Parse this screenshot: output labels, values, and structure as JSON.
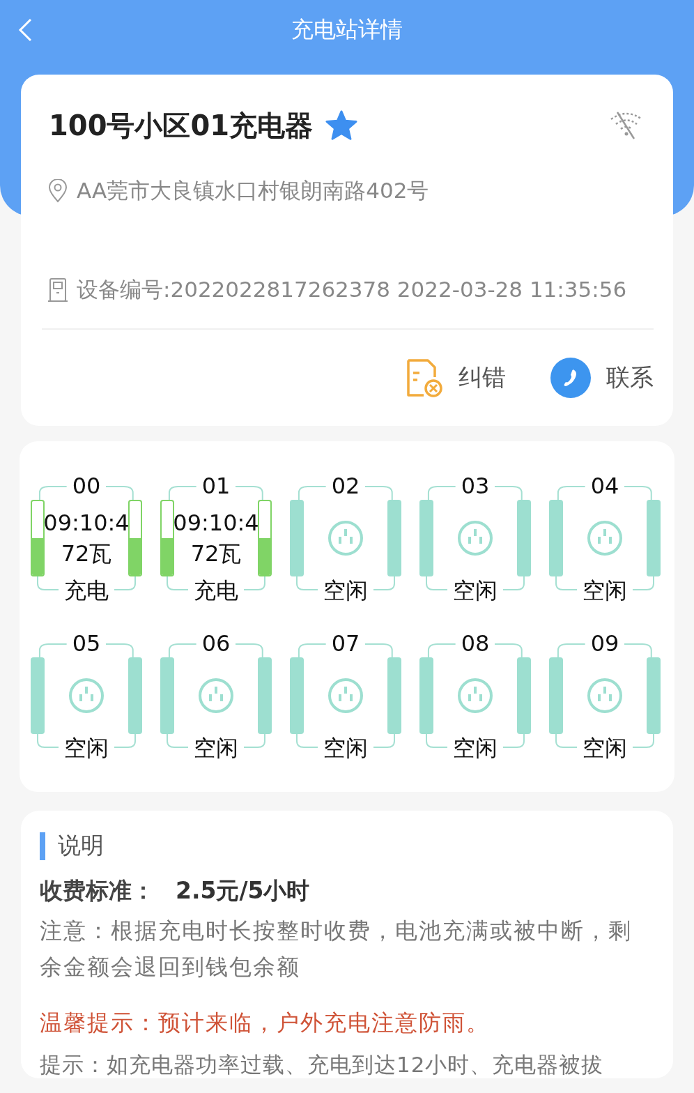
{
  "header": {
    "title": "充电站详情"
  },
  "station": {
    "name": "100号小区01充电器",
    "favorite": true,
    "online": false,
    "address": "AA莞市大良镇水口村银朗南路402号",
    "device": "设备编号:2022022817262378 2022-03-28 11:35:56",
    "actions": [
      {
        "kind": "report",
        "label": "纠错"
      },
      {
        "kind": "contact",
        "label": "联系"
      }
    ]
  },
  "ports": [
    {
      "kind": "charging",
      "number": "00",
      "time": "09:10:4",
      "power": "72瓦",
      "status": "充电",
      "level": 0.5
    },
    {
      "kind": "charging",
      "number": "01",
      "time": "09:10:4",
      "power": "72瓦",
      "status": "充电",
      "level": 0.5
    },
    {
      "kind": "idle",
      "number": "02",
      "status": "空闲"
    },
    {
      "kind": "idle",
      "number": "03",
      "status": "空闲"
    },
    {
      "kind": "idle",
      "number": "04",
      "status": "空闲"
    },
    {
      "kind": "idle",
      "number": "05",
      "status": "空闲"
    },
    {
      "kind": "idle",
      "number": "06",
      "status": "空闲"
    },
    {
      "kind": "idle",
      "number": "07",
      "status": "空闲"
    },
    {
      "kind": "idle",
      "number": "08",
      "status": "空闲"
    },
    {
      "kind": "idle",
      "number": "09",
      "status": "空闲"
    }
  ],
  "description": {
    "title": "说明",
    "fee_label": "收费标准：",
    "fee_value": "2.5元/5小时",
    "note": "注意：根据充电时长按整时收费，电池充满或被中断，剩余金额会退回到钱包余额",
    "warning": "温馨提示：预计来临，户外充电注意防雨。",
    "tip": "提示：如充电器功率过载、充电到达12小时、充电器被拔"
  }
}
